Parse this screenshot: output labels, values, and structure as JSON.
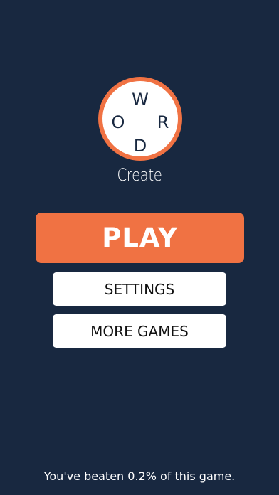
{
  "colors": {
    "background": "#182840",
    "accent": "#f07243",
    "surface": "#ffffff"
  },
  "logo": {
    "letters": {
      "top": "W",
      "left": "O",
      "right": "R",
      "bottom": "D"
    },
    "subtitle": "Create"
  },
  "menu": {
    "play_label": "PLAY",
    "settings_label": "SETTINGS",
    "more_games_label": "MORE GAMES"
  },
  "footer": {
    "stat_text": "You've beaten 0.2% of this game."
  }
}
